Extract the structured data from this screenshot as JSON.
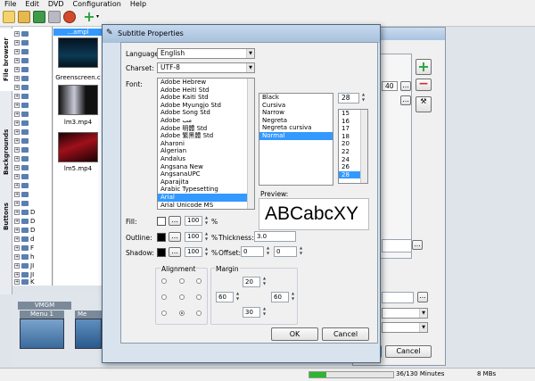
{
  "menubar": [
    "File",
    "Edit",
    "DVD",
    "Configuration",
    "Help"
  ],
  "side_tabs": [
    "File browser",
    "Backgrounds",
    "Buttons"
  ],
  "tree_items": [
    "D",
    "D",
    "D",
    "d",
    "F",
    "h",
    "JI",
    "JI",
    "K"
  ],
  "thumbnails": [
    {
      "caption": "...ampl"
    },
    {
      "caption": "Greenscreen.c"
    },
    {
      "caption": "lm3.mp4"
    },
    {
      "caption": "lm5.mp4"
    }
  ],
  "vmgm": {
    "tab": "VMGM",
    "menu1": "Menu 1",
    "menu2": "Me"
  },
  "bg_window": {
    "ok": "OK",
    "cancel": "Cancel",
    "combo_value": "40"
  },
  "status": {
    "progress": 0.2,
    "minutes": "36/130 Minutes",
    "size": "8 MBs"
  },
  "dialog": {
    "title": "Subtitle Properties",
    "language_label": "Language:",
    "language_value": "English",
    "charset_label": "Charset:",
    "charset_value": "UTF-8",
    "font_label": "Font:",
    "fonts": [
      "Adobe Hebrew",
      "Adobe Heiti Std",
      "Adobe Kaiti Std",
      "Adobe Myungjo Std",
      "Adobe Song Std",
      "Adobe مب",
      "Adobe 明體 Std",
      "Adobe 繁黑體 Std",
      "Aharoni",
      "Algerian",
      "Andalus",
      "Angsana New",
      "AngsanaUPC",
      "Aparajita",
      "Arabic Typesetting",
      "Arial",
      "Arial Unicode MS"
    ],
    "selected_font": "Arial",
    "styles": [
      "Black",
      "Cursiva",
      "Narrow",
      "Negreta",
      "Negreta cursiva",
      "Normal"
    ],
    "selected_style": "Normal",
    "size_value": "28",
    "sizes": [
      "15",
      "16",
      "17",
      "18",
      "20",
      "22",
      "24",
      "26",
      "28"
    ],
    "selected_size": "28",
    "preview_label": "Preview:",
    "preview_text": "ABCabcXY",
    "fill_label": "Fill:",
    "fill_opacity": "100",
    "outline_label": "Outline:",
    "outline_opacity": "100",
    "thickness_label": "Thickness:",
    "thickness_value": "3.0",
    "shadow_label": "Shadow:",
    "shadow_opacity": "100",
    "offset_label": "Offset:",
    "offset_x": "0",
    "offset_y": "0",
    "percent": "%",
    "ellipsis": "...",
    "alignment_label": "Alignment",
    "margin_label": "Margin",
    "margin_top": "20",
    "margin_left": "60",
    "margin_right": "60",
    "margin_bottom": "30",
    "ok": "OK",
    "cancel": "Cancel"
  }
}
